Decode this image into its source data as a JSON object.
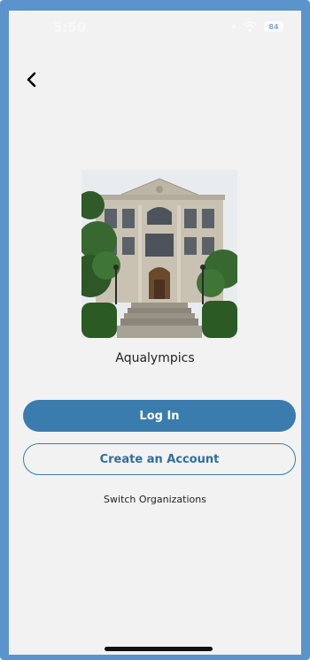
{
  "status_bar": {
    "time": "5:50",
    "battery_level": "84",
    "icons": [
      "location-icon",
      "wifi-icon",
      "battery-icon"
    ]
  },
  "nav": {
    "back_icon": "chevron-left-icon"
  },
  "organization": {
    "name": "Aqualympics",
    "logo_icon": "building-photo"
  },
  "actions": {
    "login_label": "Log In",
    "create_account_label": "Create an Account",
    "switch_org_label": "Switch Organizations"
  },
  "colors": {
    "frame": "#5b93cc",
    "primary": "#3b7cae",
    "background": "#f2f2f2"
  }
}
